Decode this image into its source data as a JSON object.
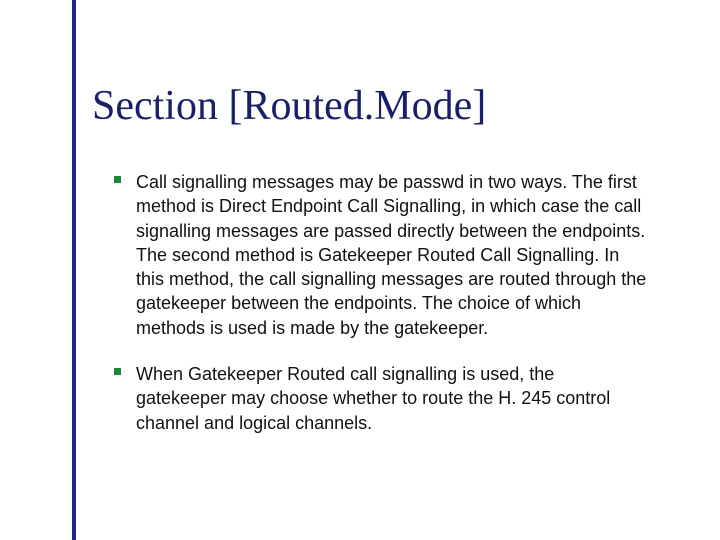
{
  "title": "Section [Routed.Mode]",
  "bullets": [
    "Call signalling messages may be passwd in two ways. The first method is Direct Endpoint Call Signalling, in which case the call signalling messages are passed directly between the endpoints. The second method is Gatekeeper Routed Call Signalling. In this method, the call signalling messages are routed through the gatekeeper between the endpoints. The choice of which methods is used is made by the gatekeeper.",
    "When Gatekeeper Routed call signalling is used, the gatekeeper may choose whether to route the H. 245 control channel and logical channels."
  ]
}
